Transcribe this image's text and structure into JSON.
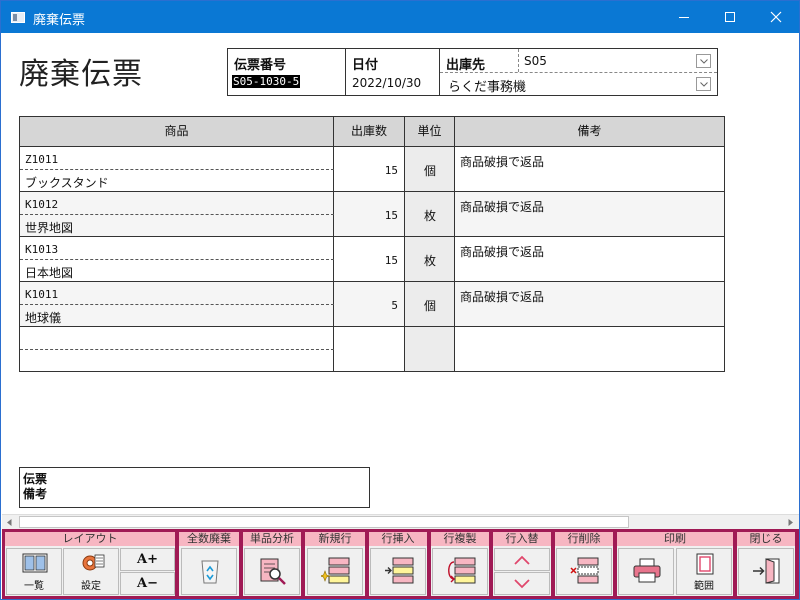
{
  "window": {
    "title": "廃棄伝票",
    "minimize_glyph": "—",
    "maximize_glyph": "□",
    "close_glyph": "✕"
  },
  "form": {
    "title": "廃棄伝票"
  },
  "header": {
    "slip_no": {
      "label": "伝票番号",
      "value": "S05-1030-5"
    },
    "date": {
      "label": "日付",
      "value": "2022/10/30"
    },
    "destination": {
      "label": "出庫先",
      "code": "S05",
      "name": "らくだ事務機"
    }
  },
  "grid": {
    "columns": {
      "product": "商品",
      "qty": "出庫数",
      "unit": "単位",
      "note": "備考"
    },
    "rows": [
      {
        "code": "Z1011",
        "name": "ブックスタンド",
        "qty": "15",
        "unit": "個",
        "note": "商品破損で返品"
      },
      {
        "code": "K1012",
        "name": "世界地図",
        "qty": "15",
        "unit": "枚",
        "note": "商品破損で返品"
      },
      {
        "code": "K1013",
        "name": "日本地図",
        "qty": "15",
        "unit": "枚",
        "note": "商品破損で返品"
      },
      {
        "code": "K1011",
        "name": "地球儀",
        "qty": "5",
        "unit": "個",
        "note": "商品破損で返品"
      },
      {
        "code": "",
        "name": "",
        "qty": "",
        "unit": "",
        "note": ""
      }
    ]
  },
  "memo": {
    "label": "伝票\n備考"
  },
  "toolbar": {
    "layout": {
      "label": "レイアウト",
      "list": "一覧",
      "settings": "設定",
      "font_up": "A+",
      "font_down": "A−"
    },
    "discard_all": {
      "label": "全数廃棄"
    },
    "item_analysis": {
      "label": "単品分析"
    },
    "new_row": {
      "label": "新規行"
    },
    "insert_row": {
      "label": "行挿入"
    },
    "copy_row": {
      "label": "行複製"
    },
    "swap_row": {
      "label": "行入替"
    },
    "delete_row": {
      "label": "行削除"
    },
    "print": {
      "label": "印刷",
      "range": "範囲"
    },
    "close": {
      "label": "閉じる"
    }
  },
  "colors": {
    "titlebar": "#0a78d4",
    "toolbar_bg": "#a01a55",
    "group_label": "#f7b6c2",
    "grid_header": "#d6d6d6"
  }
}
